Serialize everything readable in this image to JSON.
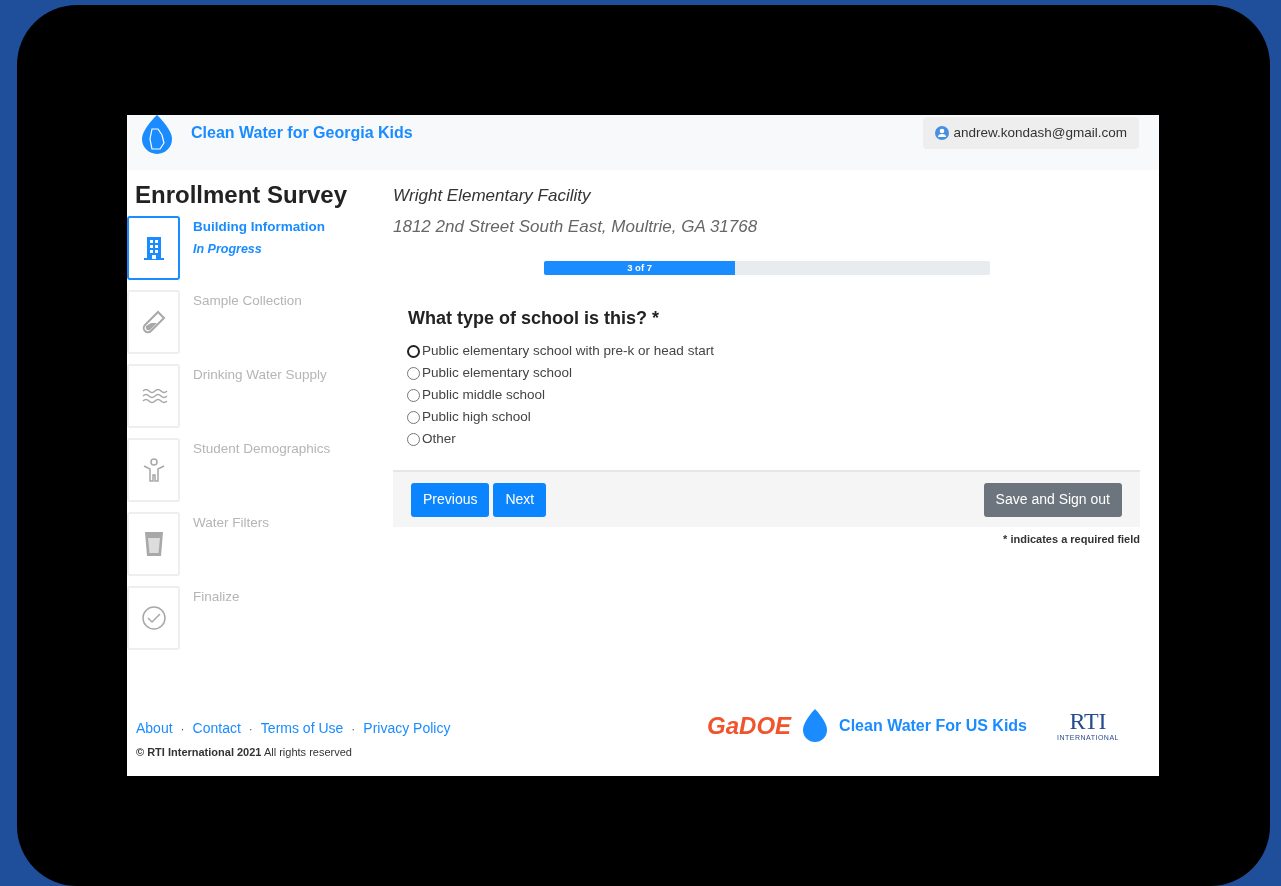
{
  "header": {
    "app_name": "Clean Water for Georgia Kids",
    "user_email": "andrew.kondash@gmail.com"
  },
  "sidebar": {
    "title": "Enrollment Survey",
    "steps": [
      {
        "label": "Building Information",
        "status": "In Progress",
        "selected": true
      },
      {
        "label": "Sample Collection",
        "selected": false
      },
      {
        "label": "Drinking Water Supply",
        "selected": false
      },
      {
        "label": "Student Demographics",
        "selected": false
      },
      {
        "label": "Water Filters",
        "selected": false
      },
      {
        "label": "Finalize",
        "selected": false
      }
    ]
  },
  "facility": {
    "name": "Wright Elementary Facility",
    "address": "1812 2nd Street South East, Moultrie, GA 31768"
  },
  "progress": {
    "label": "3 of 7",
    "level": 0.4286
  },
  "question": {
    "text": "What type of school is this? *",
    "options": [
      {
        "label": "Public elementary school with pre-k or head start",
        "selected": false,
        "focused": true
      },
      {
        "label": "Public elementary school",
        "selected": false,
        "focused": false
      },
      {
        "label": "Public middle school",
        "selected": false,
        "focused": false
      },
      {
        "label": "Public high school",
        "selected": false,
        "focused": false
      },
      {
        "label": "Other",
        "selected": false,
        "focused": false
      }
    ]
  },
  "buttons": {
    "previous": "Previous",
    "next": "Next",
    "save": "Save and Sign out"
  },
  "required_note": "* indicates a required field",
  "footer": {
    "links": [
      "About",
      "Contact",
      "Terms of Use",
      "Privacy Policy"
    ],
    "separator": "·",
    "copyright": "**© RTI International 2021** All rights reserved",
    "partner_logos": {
      "gadoe": "GaDOE",
      "clean_water": "Clean Water For US Kids",
      "rti": "RTI",
      "rti_sub": "INTERNATIONAL"
    }
  }
}
